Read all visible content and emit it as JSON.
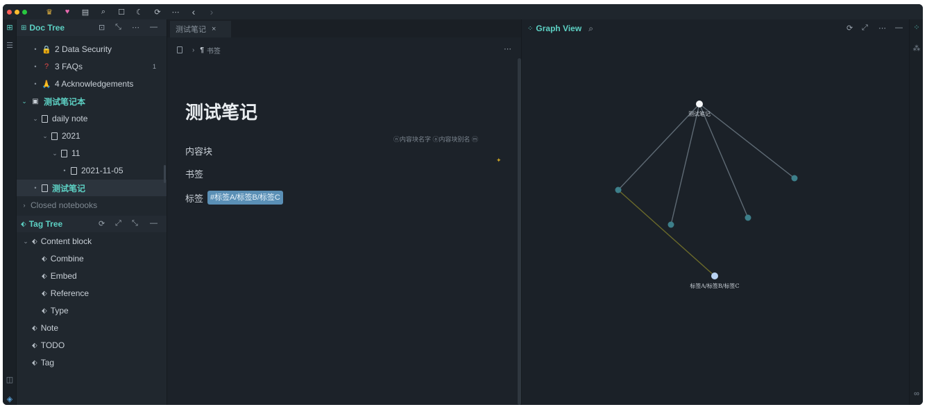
{
  "window": {
    "traffic_lights": [
      "#ff5f57",
      "#febc2e",
      "#28c840"
    ],
    "toolbar_icons": [
      "crown-icon",
      "heart-icon",
      "calendar-icon",
      "search-icon",
      "square-icon",
      "moon-icon",
      "sync-icon",
      "more-icon",
      "back-icon",
      "forward-icon"
    ]
  },
  "doc_tree": {
    "title": "Doc Tree",
    "items": [
      {
        "label": "2 Data Security",
        "icon": "lock-icon",
        "level": 1,
        "arrow": "•",
        "emoji": "🔒"
      },
      {
        "label": "3 FAQs",
        "icon": "question-icon",
        "level": 1,
        "arrow": "•",
        "emoji": "❓",
        "count": "1"
      },
      {
        "label": "4 Acknowledgements",
        "icon": "pray-icon",
        "level": 1,
        "arrow": "•",
        "emoji": "🙏"
      },
      {
        "label": "测试笔记本",
        "icon": "notebook-icon",
        "level": 0,
        "arrow": "⌄",
        "notebook": true
      },
      {
        "label": "daily note",
        "icon": "doc-icon",
        "level": 1,
        "arrow": "⌄"
      },
      {
        "label": "2021",
        "icon": "doc-icon",
        "level": 2,
        "arrow": "⌄"
      },
      {
        "label": "11",
        "icon": "doc-icon",
        "level": 3,
        "arrow": "⌄"
      },
      {
        "label": "2021-11-05",
        "icon": "doc-icon",
        "level": 4,
        "arrow": "•"
      },
      {
        "label": "测试笔记",
        "icon": "doc-icon",
        "level": 1,
        "arrow": "•",
        "selected": true
      }
    ],
    "closed_notebooks": "Closed notebooks"
  },
  "tag_tree": {
    "title": "Tag Tree",
    "items": [
      {
        "label": "Content block",
        "level": 0,
        "arrow": "⌄"
      },
      {
        "label": "Combine",
        "level": 1
      },
      {
        "label": "Embed",
        "level": 1
      },
      {
        "label": "Reference",
        "level": 1
      },
      {
        "label": "Type",
        "level": 1
      },
      {
        "label": "Note",
        "level": 0
      },
      {
        "label": "TODO",
        "level": 0
      },
      {
        "label": "Tag",
        "level": 0
      }
    ]
  },
  "editor": {
    "tab_label": "测试笔记",
    "breadcrumb_item": "书签",
    "title": "测试笔记",
    "attrs": "ⓝ内容块名字 ⓐ内容块别名 ⓜ",
    "paragraphs": [
      "内容块",
      "书签",
      "标签"
    ],
    "tag_chip": "#标签A/标签B/标签C"
  },
  "graph": {
    "title": "Graph View",
    "nodes": [
      {
        "id": "root",
        "label": "测试笔记",
        "color": "#f5f7f9",
        "r": 5
      },
      {
        "id": "n1",
        "label": "",
        "color": "#3d7f8a",
        "r": 4.5
      },
      {
        "id": "n2",
        "label": "",
        "color": "#3d7f8a",
        "r": 4.5
      },
      {
        "id": "n3",
        "label": "",
        "color": "#3d7f8a",
        "r": 4.5
      },
      {
        "id": "n4",
        "label": "",
        "color": "#3d7f8a",
        "r": 4.5
      },
      {
        "id": "tagnode",
        "label": "标签A/标签B/标签C",
        "color": "#b9d3f2",
        "r": 5
      }
    ],
    "edges": [
      [
        "root",
        "n1"
      ],
      [
        "root",
        "n2"
      ],
      [
        "root",
        "n3"
      ],
      [
        "root",
        "n4"
      ],
      [
        "n1",
        "tagnode"
      ]
    ]
  }
}
